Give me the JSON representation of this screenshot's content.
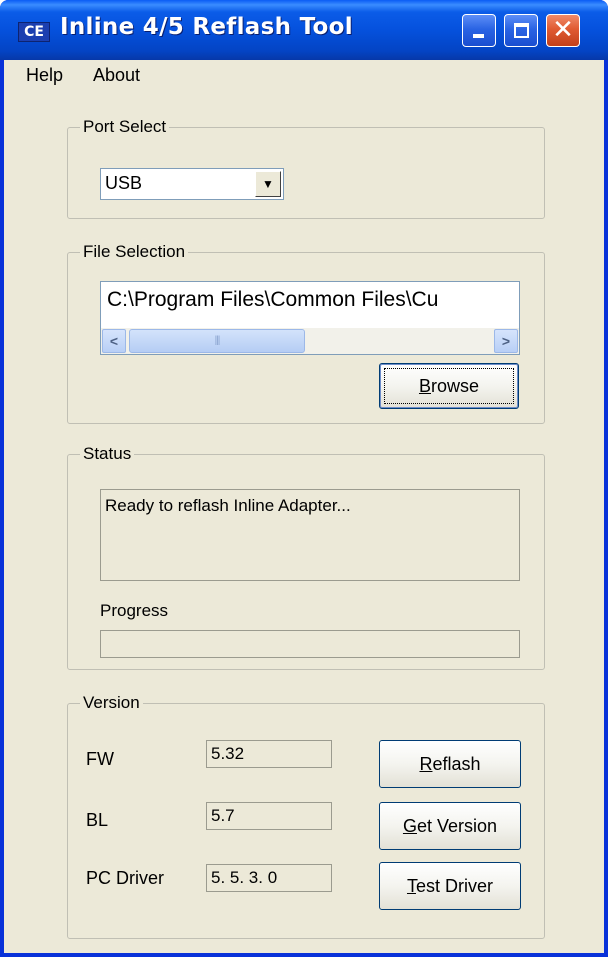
{
  "window": {
    "app_icon_text": "CE",
    "title": "Inline 4/5  Reflash Tool",
    "title_buttons": {
      "minimize": "minimize-icon",
      "maximize": "maximize-icon",
      "close": "close-icon"
    },
    "colors": {
      "titlebar": "#0551dd",
      "client": "#ece9d8",
      "close_button": "#e05b32"
    }
  },
  "menu": {
    "items": [
      "Help",
      "About"
    ]
  },
  "port_select": {
    "title": "Port Select",
    "selected": "USB",
    "dropdown_icon": "chevron-down-icon"
  },
  "file_selection": {
    "title": "File Selection",
    "path": "C:\\Program Files\\Common Files\\Cu",
    "scroll_left_icon": "chevron-left-icon",
    "scroll_right_icon": "chevron-right-icon",
    "browse_label": "Browse",
    "browse_mnemonic": "B",
    "browse_rest": "rowse"
  },
  "status": {
    "title": "Status",
    "message": "Ready to reflash Inline Adapter...",
    "progress_label": "Progress",
    "progress": 0
  },
  "version": {
    "title": "Version",
    "fw_label": "FW",
    "fw_value": "5.32",
    "bl_label": "BL",
    "bl_value": "5.7",
    "pc_driver_label": "PC Driver",
    "pc_driver_value": "5. 5. 3. 0",
    "reflash": {
      "mnemonic": "R",
      "rest": "eflash"
    },
    "get_version": {
      "mnemonic": "G",
      "rest": "et Version"
    },
    "test_driver": {
      "mnemonic": "T",
      "rest": "est Driver"
    }
  }
}
